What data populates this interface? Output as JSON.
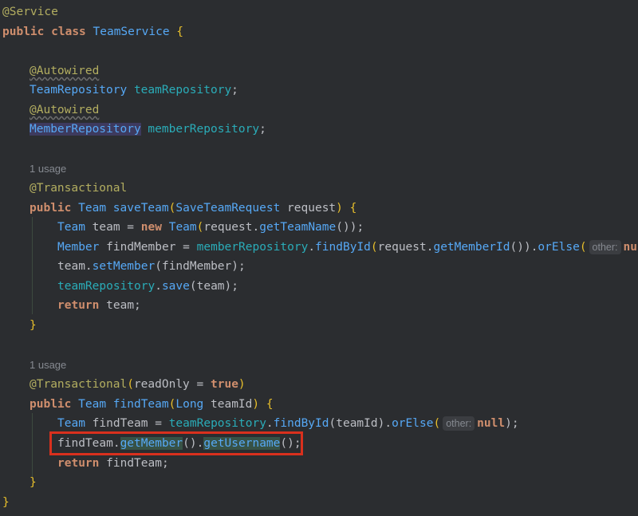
{
  "code": {
    "l1_ann": "@Service",
    "l2_kw1": "public",
    "l2_kw2": "class",
    "l2_name": "TeamService",
    "l2_brace": "{",
    "l4_ann": "@Autowired",
    "l5_type": "TeamRepository",
    "l5_field": "teamRepository",
    "l5_semi": ";",
    "l6_ann": "@Autowired",
    "l7_type": "MemberRepository",
    "l7_field": "memberRepository",
    "l7_semi": ";",
    "usage1": "1 usage",
    "l10_ann": "@Transactional",
    "l11_kw": "public",
    "l11_type": "Team",
    "l11_method": "saveTeam",
    "l11_open": "(",
    "l11_ptype": "SaveTeamRequest",
    "l11_param": "request",
    "l11_close": ")",
    "l11_brace": "{",
    "l12_type": "Team",
    "l12_rest1": "team =",
    "l12_new": "new",
    "l12_ctor": "Team",
    "l12_p1": "(",
    "l12_arg": "request.",
    "l12_call": "getTeamName",
    "l12_p2": "());",
    "l13_type": "Member",
    "l13_var": "findMember =",
    "l13_field": "memberRepository",
    "l13_dot1": ".",
    "l13_call1": "findById",
    "l13_p1": "(",
    "l13_arg": "request.",
    "l13_call2": "getMemberId",
    "l13_p2": "()).",
    "l13_call3": "orElse",
    "l13_p3": "(",
    "l13_hint": "other:",
    "l13_tail": "nu",
    "l14_obj": "team.",
    "l14_call": "setMember",
    "l14_args": "(findMember);",
    "l15_field": "teamRepository",
    "l15_dot": ".",
    "l15_call": "save",
    "l15_args": "(team);",
    "l16_kw": "return",
    "l16_rest": "team;",
    "l17_brace": "}",
    "usage2": "1 usage",
    "l20_ann": "@Transactional",
    "l20_p1": "(",
    "l20_attr": "readOnly =",
    "l20_true": "true",
    "l20_p2": ")",
    "l21_kw": "public",
    "l21_type": "Team",
    "l21_method": "findTeam",
    "l21_open": "(",
    "l21_ptype": "Long",
    "l21_param": "teamId",
    "l21_close": ")",
    "l21_brace": "{",
    "l22_type": "Team",
    "l22_var": "findTeam =",
    "l22_field": "teamRepository",
    "l22_dot": ".",
    "l22_call1": "findById",
    "l22_args": "(teamId).",
    "l22_call2": "orElse",
    "l22_p1": "(",
    "l22_hint": "other:",
    "l22_null": "null",
    "l22_p2": ");",
    "l23_obj": "findTeam.",
    "l23_call1": "getMember",
    "l23_mid": "().",
    "l23_call2": "getUsername",
    "l23_end": "();",
    "l24_kw": "return",
    "l24_rest": "findTeam;",
    "l25_brace": "}",
    "l26_brace": "}"
  },
  "colors": {
    "background": "#2b2d30",
    "keyword": "#cf8e6d",
    "annotation": "#b3ae60",
    "type": "#56a8f5",
    "field": "#2aacb8",
    "highlight_box": "#d9301d"
  }
}
